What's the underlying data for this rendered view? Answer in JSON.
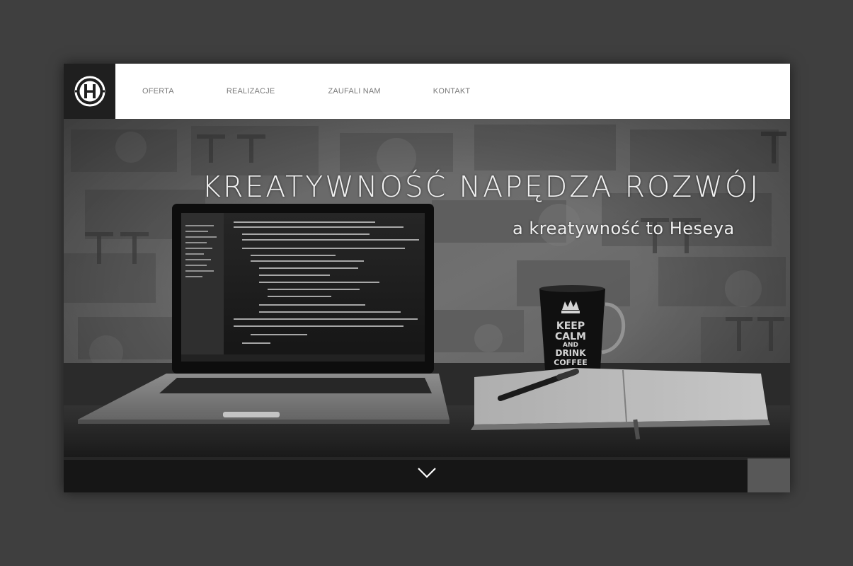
{
  "header": {
    "logo_letter": "H",
    "nav": [
      {
        "label": "OFERTA"
      },
      {
        "label": "REALIZACJE"
      },
      {
        "label": "ZAUFALI NAM"
      },
      {
        "label": "KONTAKT"
      }
    ]
  },
  "hero": {
    "headline": "KREATYWNOŚĆ NAPĘDZA ROZWÓJ",
    "subline": "a kreatywność to Heseya",
    "mug_text": [
      "KEEP",
      "CALM",
      "AND",
      "DRINK",
      "COFFEE"
    ],
    "scroll_icon": "chevron-down-icon"
  },
  "colors": {
    "page_background": "#3f3f3f",
    "logo_box": "#1f1f1f",
    "nav_text": "#7a7a7a",
    "hero_text": "#f2f2f2"
  }
}
